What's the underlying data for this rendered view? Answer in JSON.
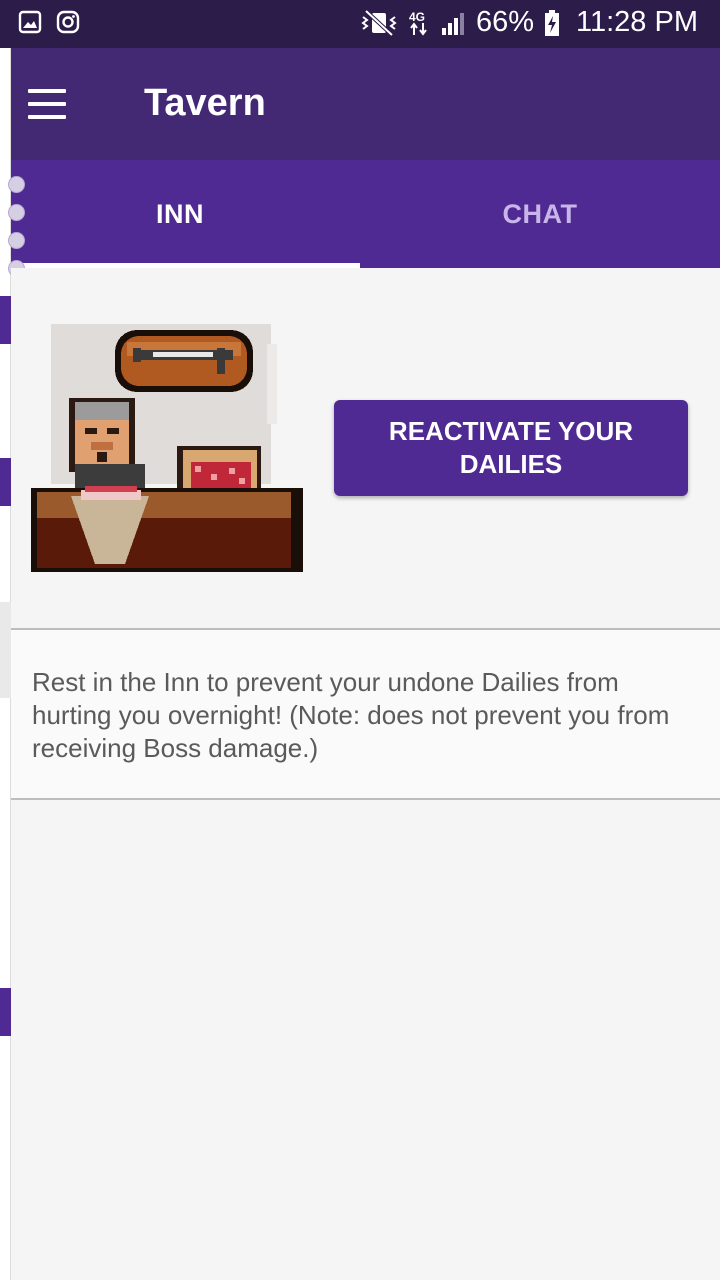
{
  "status_bar": {
    "left_icons": [
      "gallery-icon",
      "instagram-icon"
    ],
    "right_icons": [
      "mute-vibrate-icon",
      "network-4g-icon",
      "signal-icon",
      "battery-charging-icon"
    ],
    "network": "4G",
    "battery": "66%",
    "time": "11:28 PM"
  },
  "app_bar": {
    "title": "Tavern",
    "menu_icon": "hamburger-menu-icon"
  },
  "tabs": [
    {
      "label": "INN",
      "active": true
    },
    {
      "label": "CHAT",
      "active": false
    }
  ],
  "inn": {
    "image_icon": "tavern-innkeeper-illustration",
    "reactivate_button": "REACTIVATE YOUR DAILIES",
    "description": "Rest in the Inn to prevent your undone Dailies from hurting you overnight! (Note: does not prevent you from receiving Boss damage.)"
  },
  "colors": {
    "status_bar": "#2c1c4a",
    "app_bar": "#432874",
    "tab_bar": "#4f2a93",
    "button": "#4f2a93",
    "background": "#f5f5f5"
  }
}
